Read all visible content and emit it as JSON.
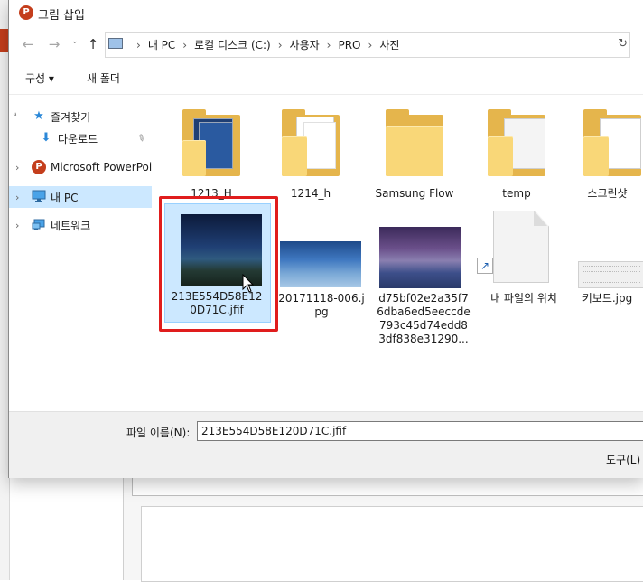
{
  "window": {
    "title": "그림 삽입",
    "app_icon_letter": "P"
  },
  "nav": {
    "back_glyph": "←",
    "forward_glyph": "→",
    "dropdown_glyph": "⌄",
    "up_glyph": "↑",
    "breadcrumbs": [
      "내 PC",
      "로컬 디스크 (C:)",
      "사용자",
      "PRO",
      "사진"
    ],
    "sep_glyph": "›",
    "refresh_glyph": "↻"
  },
  "toolbar": {
    "organize_label": "구성 ▾",
    "new_folder_label": "새 폴더"
  },
  "sidebar": {
    "items": [
      {
        "label": "즐겨찾기",
        "icon": "star-icon",
        "glyph": "★",
        "color": "#2b88d8",
        "chevron": "˅"
      },
      {
        "label": "다운로드",
        "icon": "download-icon",
        "glyph": "⬇",
        "color": "#2b88d8",
        "pin": "📌"
      },
      {
        "label": "Microsoft PowerPoin",
        "icon": "powerpoint-icon",
        "glyph": "P",
        "color": "#c43e1c",
        "chevron": "›"
      },
      {
        "label": "내 PC",
        "icon": "pc-icon",
        "glyph": "🖥",
        "color": "#2b88d8",
        "chevron": "›",
        "selected": true
      },
      {
        "label": "네트워크",
        "icon": "network-icon",
        "glyph": "🖧",
        "color": "#2b88d8",
        "chevron": "›"
      }
    ]
  },
  "files": {
    "row1": [
      {
        "name": "1213_H",
        "type": "folder"
      },
      {
        "name": "1214_h",
        "type": "folder"
      },
      {
        "name": "Samsung Flow",
        "type": "folder"
      },
      {
        "name": "temp",
        "type": "folder"
      },
      {
        "name": "스크린샷",
        "type": "folder"
      }
    ],
    "row2": [
      {
        "name_lines": [
          "213E554D58E12",
          "0D71C.jfif"
        ],
        "type": "image",
        "selected": true
      },
      {
        "name_lines": [
          "20171118-006.j",
          "pg"
        ],
        "type": "image"
      },
      {
        "name_lines": [
          "d75bf02e2a35f7",
          "6dba6ed5eeccde",
          "793c45d74edd8",
          "3df838e31290..."
        ],
        "type": "image"
      },
      {
        "name_lines": [
          "내 파일의 위치"
        ],
        "type": "shortcut"
      },
      {
        "name_lines": [
          "키보드.jpg"
        ],
        "type": "image"
      }
    ]
  },
  "bottom": {
    "filename_label": "파일 이름(N):",
    "filename_value": "213E554D58E120D71C.jfif",
    "tools_label": "도구(L)"
  },
  "colors": {
    "selection": "#cce8ff",
    "highlight_box": "#e01d1d",
    "folder": "#f9d778",
    "accent": "#c43e1c"
  }
}
